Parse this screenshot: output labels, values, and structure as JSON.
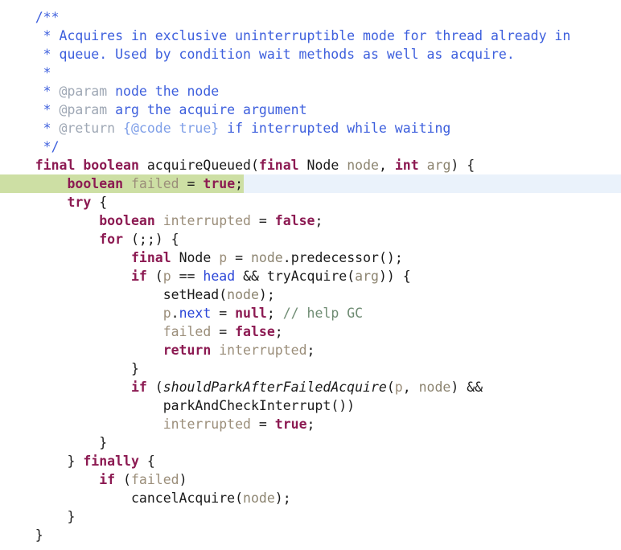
{
  "editor": {
    "language": "java",
    "colors": {
      "background": "#ffffff",
      "caret_line": "#eaf2fb",
      "selection": "#cddfa4",
      "javadoc": "#3d5fdd",
      "javadoc_tag": "#9fa8b5",
      "javadoc_inline_tag": "#7f9fe8",
      "keyword": "#8c1a52",
      "plain": "#1a1a1a",
      "local_variable": "#9b8e7a",
      "parameter": "#8c8470",
      "field": "#2b46d8",
      "comment": "#6f8c73"
    }
  },
  "code": {
    "lines": [
      {
        "id": "line-1",
        "highlight": "none",
        "tokens": [
          {
            "text": "    ",
            "type": "plain"
          },
          {
            "text": "/**",
            "type": "doc"
          }
        ]
      },
      {
        "id": "line-2",
        "highlight": "none",
        "tokens": [
          {
            "text": "     * Acquires in exclusive uninterruptible mode for thread already in",
            "type": "doc"
          }
        ]
      },
      {
        "id": "line-3",
        "highlight": "none",
        "tokens": [
          {
            "text": "     * queue. Used by condition wait methods as well as acquire.",
            "type": "doc"
          }
        ]
      },
      {
        "id": "line-4",
        "highlight": "none",
        "tokens": [
          {
            "text": "     *",
            "type": "doc"
          }
        ]
      },
      {
        "id": "line-5",
        "highlight": "none",
        "tokens": [
          {
            "text": "     * ",
            "type": "doc"
          },
          {
            "text": "@param",
            "type": "doc-tag"
          },
          {
            "text": " node the node",
            "type": "doc"
          }
        ]
      },
      {
        "id": "line-6",
        "highlight": "none",
        "tokens": [
          {
            "text": "     * ",
            "type": "doc"
          },
          {
            "text": "@param",
            "type": "doc-tag"
          },
          {
            "text": " arg the acquire argument",
            "type": "doc"
          }
        ]
      },
      {
        "id": "line-7",
        "highlight": "none",
        "tokens": [
          {
            "text": "     * ",
            "type": "doc"
          },
          {
            "text": "@return",
            "type": "doc-tag"
          },
          {
            "text": " ",
            "type": "doc"
          },
          {
            "text": "{@code true}",
            "type": "doc-inline"
          },
          {
            "text": " if interrupted while waiting",
            "type": "doc"
          }
        ]
      },
      {
        "id": "line-8",
        "highlight": "none",
        "tokens": [
          {
            "text": "     */",
            "type": "doc"
          }
        ]
      },
      {
        "id": "line-9",
        "highlight": "none",
        "tokens": [
          {
            "text": "    ",
            "type": "plain"
          },
          {
            "text": "final",
            "type": "keyword"
          },
          {
            "text": " ",
            "type": "plain"
          },
          {
            "text": "boolean",
            "type": "keyword"
          },
          {
            "text": " ",
            "type": "plain"
          },
          {
            "text": "acquireQueued",
            "type": "method"
          },
          {
            "text": "(",
            "type": "punct"
          },
          {
            "text": "final",
            "type": "keyword"
          },
          {
            "text": " ",
            "type": "plain"
          },
          {
            "text": "Node",
            "type": "plain"
          },
          {
            "text": " ",
            "type": "plain"
          },
          {
            "text": "node",
            "type": "parameter"
          },
          {
            "text": ", ",
            "type": "punct"
          },
          {
            "text": "int",
            "type": "keyword"
          },
          {
            "text": " ",
            "type": "plain"
          },
          {
            "text": "arg",
            "type": "parameter"
          },
          {
            "text": ") {",
            "type": "punct"
          }
        ]
      },
      {
        "id": "line-10",
        "highlight": "caret-and-selection",
        "tokens": [
          {
            "text": "        ",
            "type": "plain"
          },
          {
            "text": "boolean",
            "type": "keyword"
          },
          {
            "text": " ",
            "type": "plain"
          },
          {
            "text": "failed",
            "type": "variable"
          },
          {
            "text": " = ",
            "type": "punct"
          },
          {
            "text": "true",
            "type": "keyword"
          },
          {
            "text": ";",
            "type": "punct"
          }
        ]
      },
      {
        "id": "line-11",
        "highlight": "none",
        "tokens": [
          {
            "text": "        ",
            "type": "plain"
          },
          {
            "text": "try",
            "type": "keyword"
          },
          {
            "text": " {",
            "type": "punct"
          }
        ]
      },
      {
        "id": "line-12",
        "highlight": "none",
        "tokens": [
          {
            "text": "            ",
            "type": "plain"
          },
          {
            "text": "boolean",
            "type": "keyword"
          },
          {
            "text": " ",
            "type": "plain"
          },
          {
            "text": "interrupted",
            "type": "variable"
          },
          {
            "text": " = ",
            "type": "punct"
          },
          {
            "text": "false",
            "type": "keyword"
          },
          {
            "text": ";",
            "type": "punct"
          }
        ]
      },
      {
        "id": "line-13",
        "highlight": "none",
        "tokens": [
          {
            "text": "            ",
            "type": "plain"
          },
          {
            "text": "for",
            "type": "keyword"
          },
          {
            "text": " (;;) {",
            "type": "punct"
          }
        ]
      },
      {
        "id": "line-14",
        "highlight": "none",
        "tokens": [
          {
            "text": "                ",
            "type": "plain"
          },
          {
            "text": "final",
            "type": "keyword"
          },
          {
            "text": " ",
            "type": "plain"
          },
          {
            "text": "Node",
            "type": "plain"
          },
          {
            "text": " ",
            "type": "plain"
          },
          {
            "text": "p",
            "type": "variable"
          },
          {
            "text": " = ",
            "type": "punct"
          },
          {
            "text": "node",
            "type": "parameter"
          },
          {
            "text": ".",
            "type": "punct"
          },
          {
            "text": "predecessor",
            "type": "method"
          },
          {
            "text": "();",
            "type": "punct"
          }
        ]
      },
      {
        "id": "line-15",
        "highlight": "none",
        "tokens": [
          {
            "text": "                ",
            "type": "plain"
          },
          {
            "text": "if",
            "type": "keyword"
          },
          {
            "text": " (",
            "type": "punct"
          },
          {
            "text": "p",
            "type": "variable"
          },
          {
            "text": " == ",
            "type": "punct"
          },
          {
            "text": "head",
            "type": "field"
          },
          {
            "text": " && ",
            "type": "punct"
          },
          {
            "text": "tryAcquire",
            "type": "method"
          },
          {
            "text": "(",
            "type": "punct"
          },
          {
            "text": "arg",
            "type": "parameter"
          },
          {
            "text": ")) {",
            "type": "punct"
          }
        ]
      },
      {
        "id": "line-16",
        "highlight": "none",
        "tokens": [
          {
            "text": "                    ",
            "type": "plain"
          },
          {
            "text": "setHead",
            "type": "method"
          },
          {
            "text": "(",
            "type": "punct"
          },
          {
            "text": "node",
            "type": "parameter"
          },
          {
            "text": ");",
            "type": "punct"
          }
        ]
      },
      {
        "id": "line-17",
        "highlight": "none",
        "tokens": [
          {
            "text": "                    ",
            "type": "plain"
          },
          {
            "text": "p",
            "type": "variable"
          },
          {
            "text": ".",
            "type": "punct"
          },
          {
            "text": "next",
            "type": "field"
          },
          {
            "text": " = ",
            "type": "punct"
          },
          {
            "text": "null",
            "type": "keyword"
          },
          {
            "text": "; ",
            "type": "punct"
          },
          {
            "text": "// help GC",
            "type": "comment"
          }
        ]
      },
      {
        "id": "line-18",
        "highlight": "none",
        "tokens": [
          {
            "text": "                    ",
            "type": "plain"
          },
          {
            "text": "failed",
            "type": "variable"
          },
          {
            "text": " = ",
            "type": "punct"
          },
          {
            "text": "false",
            "type": "keyword"
          },
          {
            "text": ";",
            "type": "punct"
          }
        ]
      },
      {
        "id": "line-19",
        "highlight": "none",
        "tokens": [
          {
            "text": "                    ",
            "type": "plain"
          },
          {
            "text": "return",
            "type": "keyword"
          },
          {
            "text": " ",
            "type": "plain"
          },
          {
            "text": "interrupted",
            "type": "variable"
          },
          {
            "text": ";",
            "type": "punct"
          }
        ]
      },
      {
        "id": "line-20",
        "highlight": "none",
        "tokens": [
          {
            "text": "                }",
            "type": "punct"
          }
        ]
      },
      {
        "id": "line-21",
        "highlight": "none",
        "tokens": [
          {
            "text": "                ",
            "type": "plain"
          },
          {
            "text": "if",
            "type": "keyword"
          },
          {
            "text": " (",
            "type": "punct"
          },
          {
            "text": "shouldParkAfterFailedAcquire",
            "type": "static-method"
          },
          {
            "text": "(",
            "type": "punct"
          },
          {
            "text": "p",
            "type": "variable"
          },
          {
            "text": ", ",
            "type": "punct"
          },
          {
            "text": "node",
            "type": "parameter"
          },
          {
            "text": ") &&",
            "type": "punct"
          }
        ]
      },
      {
        "id": "line-22",
        "highlight": "none",
        "tokens": [
          {
            "text": "                    ",
            "type": "plain"
          },
          {
            "text": "parkAndCheckInterrupt",
            "type": "method"
          },
          {
            "text": "())",
            "type": "punct"
          }
        ]
      },
      {
        "id": "line-23",
        "highlight": "none",
        "tokens": [
          {
            "text": "                    ",
            "type": "plain"
          },
          {
            "text": "interrupted",
            "type": "variable"
          },
          {
            "text": " = ",
            "type": "punct"
          },
          {
            "text": "true",
            "type": "keyword"
          },
          {
            "text": ";",
            "type": "punct"
          }
        ]
      },
      {
        "id": "line-24",
        "highlight": "none",
        "tokens": [
          {
            "text": "            }",
            "type": "punct"
          }
        ]
      },
      {
        "id": "line-25",
        "highlight": "none",
        "tokens": [
          {
            "text": "        } ",
            "type": "punct"
          },
          {
            "text": "finally",
            "type": "keyword"
          },
          {
            "text": " {",
            "type": "punct"
          }
        ]
      },
      {
        "id": "line-26",
        "highlight": "none",
        "tokens": [
          {
            "text": "            ",
            "type": "plain"
          },
          {
            "text": "if",
            "type": "keyword"
          },
          {
            "text": " (",
            "type": "punct"
          },
          {
            "text": "failed",
            "type": "variable"
          },
          {
            "text": ")",
            "type": "punct"
          }
        ]
      },
      {
        "id": "line-27",
        "highlight": "none",
        "tokens": [
          {
            "text": "                ",
            "type": "plain"
          },
          {
            "text": "cancelAcquire",
            "type": "method"
          },
          {
            "text": "(",
            "type": "punct"
          },
          {
            "text": "node",
            "type": "parameter"
          },
          {
            "text": ");",
            "type": "punct"
          }
        ]
      },
      {
        "id": "line-28",
        "highlight": "none",
        "tokens": [
          {
            "text": "        }",
            "type": "punct"
          }
        ]
      },
      {
        "id": "line-29",
        "highlight": "none",
        "tokens": [
          {
            "text": "    }",
            "type": "punct"
          }
        ]
      }
    ]
  }
}
